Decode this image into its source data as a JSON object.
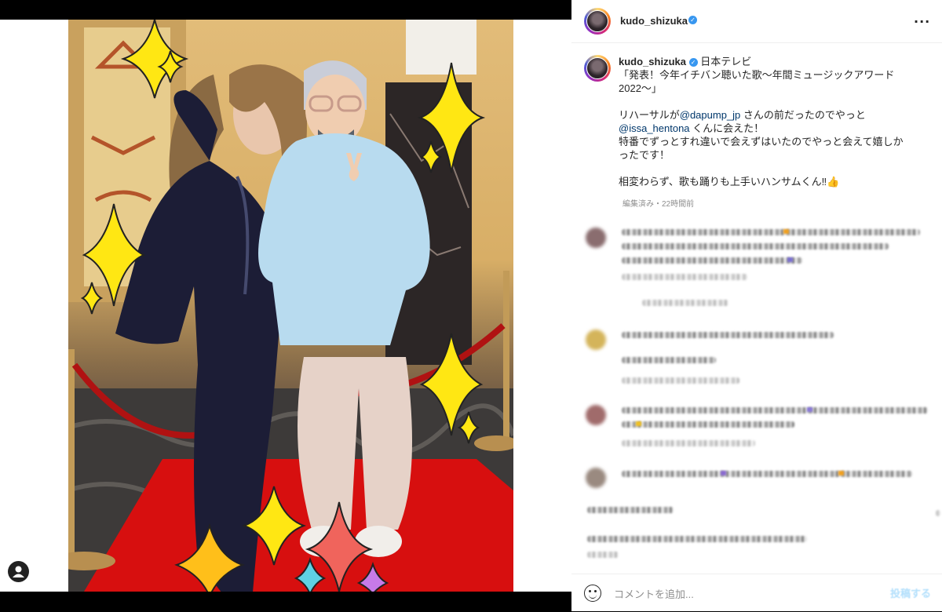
{
  "post": {
    "author": {
      "username": "kudo_shizuka",
      "verified": true
    },
    "caption": {
      "username": "kudo_shizuka",
      "channel": "日本テレビ",
      "title_lines": [
        "「発表！今年イチバン聴いた歌～年間ミュージックアワード",
        "2022～」"
      ],
      "line_a_pre": "リハーサルが",
      "mention_1": "@dapump_jp",
      "line_a_post": " さんの前だったのでやっと",
      "mention_2": "@issa_hentona",
      "line_b_post": " くんに会えた！",
      "body_lines": [
        "特番でずっとすれ違いで会えずはいたのでやっと会えて嬉しか",
        "ったです！"
      ],
      "closing": "相変わらず、歌も踊りも上手いハンサムくん‼︎👍"
    },
    "edit_meta": "編集済み・22時間前",
    "more_icon": "more-horizontal-icon",
    "comment_box": {
      "placeholder": "コメントを追加...",
      "post_label": "投稿する"
    },
    "colors": {
      "accent": "#3897f0",
      "link": "#00376b",
      "muted": "#8e8e8e"
    }
  }
}
